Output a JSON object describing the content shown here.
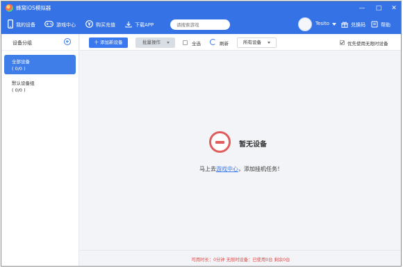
{
  "app": {
    "title": "蜂窝iOS模拟器",
    "controls": {
      "minimize": "—",
      "maximize": "□",
      "close": "✕"
    }
  },
  "nav": {
    "items": [
      {
        "label": "我的设备",
        "icon": "phone-icon",
        "active": true
      },
      {
        "label": "游戏中心",
        "icon": "gamepad-icon",
        "active": false
      },
      {
        "label": "购买充值",
        "icon": "coin-icon",
        "active": false
      },
      {
        "label": "下载APP",
        "icon": "download-icon",
        "active": false
      }
    ],
    "search_placeholder": "请搜索游戏",
    "user": {
      "name": "Tesito"
    },
    "right": [
      {
        "label": "兑换码",
        "icon": "gift-icon"
      },
      {
        "label": "帮助",
        "icon": "help-book-icon"
      }
    ]
  },
  "sidebar": {
    "title": "设备分组",
    "groups": [
      {
        "name": "全部设备",
        "count": "( 0/0 )",
        "active": true
      },
      {
        "name": "默认设备组",
        "count": "( 0/0 )",
        "active": false
      }
    ]
  },
  "toolbar": {
    "add_device": "十 添加新设备",
    "batch_ops": "批量操作",
    "select_all": "全选",
    "refresh": "刷新",
    "device_filter": "所有设备",
    "prefer_unlimited": "优先使用无限时设备",
    "prefer_unlimited_checked": true
  },
  "empty_state": {
    "title": "暂无设备",
    "desc_prefix": "马上去",
    "desc_link": "游戏中心",
    "desc_suffix": "，添加挂机任务！"
  },
  "footer": {
    "status": "可用时长：0分钟 无限时设备：已使用0台 剩余0台"
  },
  "colors": {
    "brand": "#3572e6",
    "accent": "#3a78f0",
    "danger": "#e05c5c",
    "footer_text": "#e04848"
  }
}
